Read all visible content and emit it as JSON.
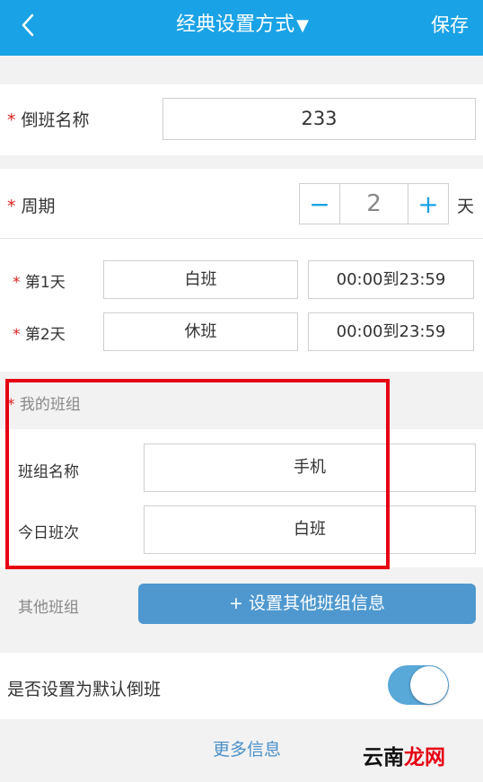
{
  "header": {
    "back_icon": "chevron-left-icon",
    "title": "经典设置方式",
    "title_caret": "▼",
    "save_label": "保存",
    "color": "#1aa2e6"
  },
  "shift_name": {
    "required_mark": "*",
    "label": "倒班名称",
    "value": "233"
  },
  "period": {
    "required_mark": "*",
    "label": "周期",
    "minus_label": "−",
    "value": "2",
    "plus_label": "+",
    "unit": "天"
  },
  "days": [
    {
      "required_mark": "*",
      "label": "第1天",
      "shift": "白班",
      "time": "00:00到23:59"
    },
    {
      "required_mark": "*",
      "label": "第2天",
      "shift": "休班",
      "time": "00:00到23:59"
    }
  ],
  "my_group": {
    "required_mark": "*",
    "title": "我的班组",
    "name_label": "班组名称",
    "name_value": "手机",
    "today_label": "今日班次",
    "today_value": "白班"
  },
  "other_group": {
    "label": "其他班组",
    "button_label": "+ 设置其他班组信息",
    "button_color": "#4f98cf"
  },
  "default_setting": {
    "label": "是否设置为默认倒班",
    "toggle_on": true
  },
  "more_label": "更多信息",
  "watermark": {
    "part1": "云南",
    "part2": "龙网",
    "color1": "#111111",
    "color2": "#e60012"
  }
}
